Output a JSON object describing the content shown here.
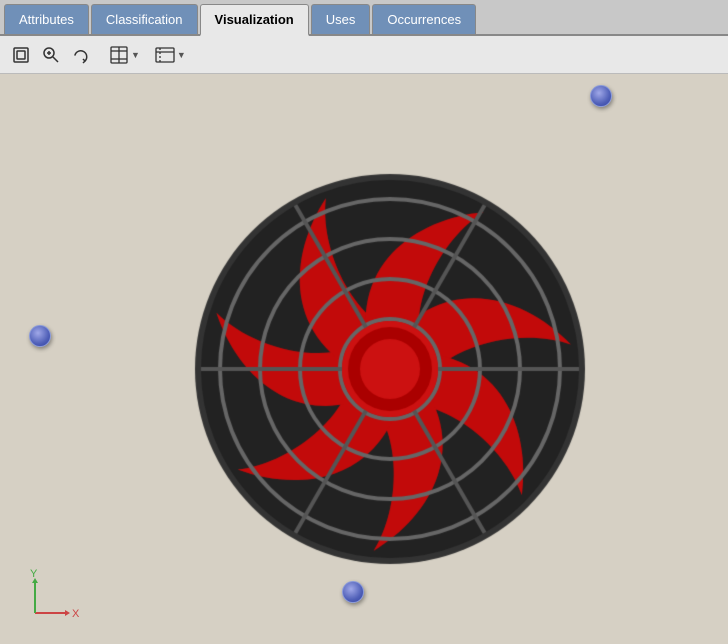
{
  "tabs": [
    {
      "id": "attributes",
      "label": "Attributes",
      "active": false
    },
    {
      "id": "classification",
      "label": "Classification",
      "active": false
    },
    {
      "id": "visualization",
      "label": "Visualization",
      "active": true
    },
    {
      "id": "uses",
      "label": "Uses",
      "active": false
    },
    {
      "id": "occurrences",
      "label": "Occurrences",
      "active": false
    }
  ],
  "toolbar": {
    "buttons": [
      {
        "id": "reset",
        "icon": "⊡",
        "title": "Reset View"
      },
      {
        "id": "zoom",
        "icon": "🔍",
        "title": "Zoom"
      },
      {
        "id": "rotate",
        "icon": "↻",
        "title": "Rotate"
      }
    ]
  },
  "viewport": {
    "background": "#d6d0c4"
  },
  "handles": [
    {
      "id": "handle-top-right",
      "top": "2%",
      "left": "81%"
    },
    {
      "id": "handle-left",
      "top": "44%",
      "left": "4%"
    },
    {
      "id": "handle-bottom",
      "top": "89%",
      "left": "47%"
    }
  ],
  "axis": {
    "x_label": "X",
    "y_label": "Y"
  }
}
